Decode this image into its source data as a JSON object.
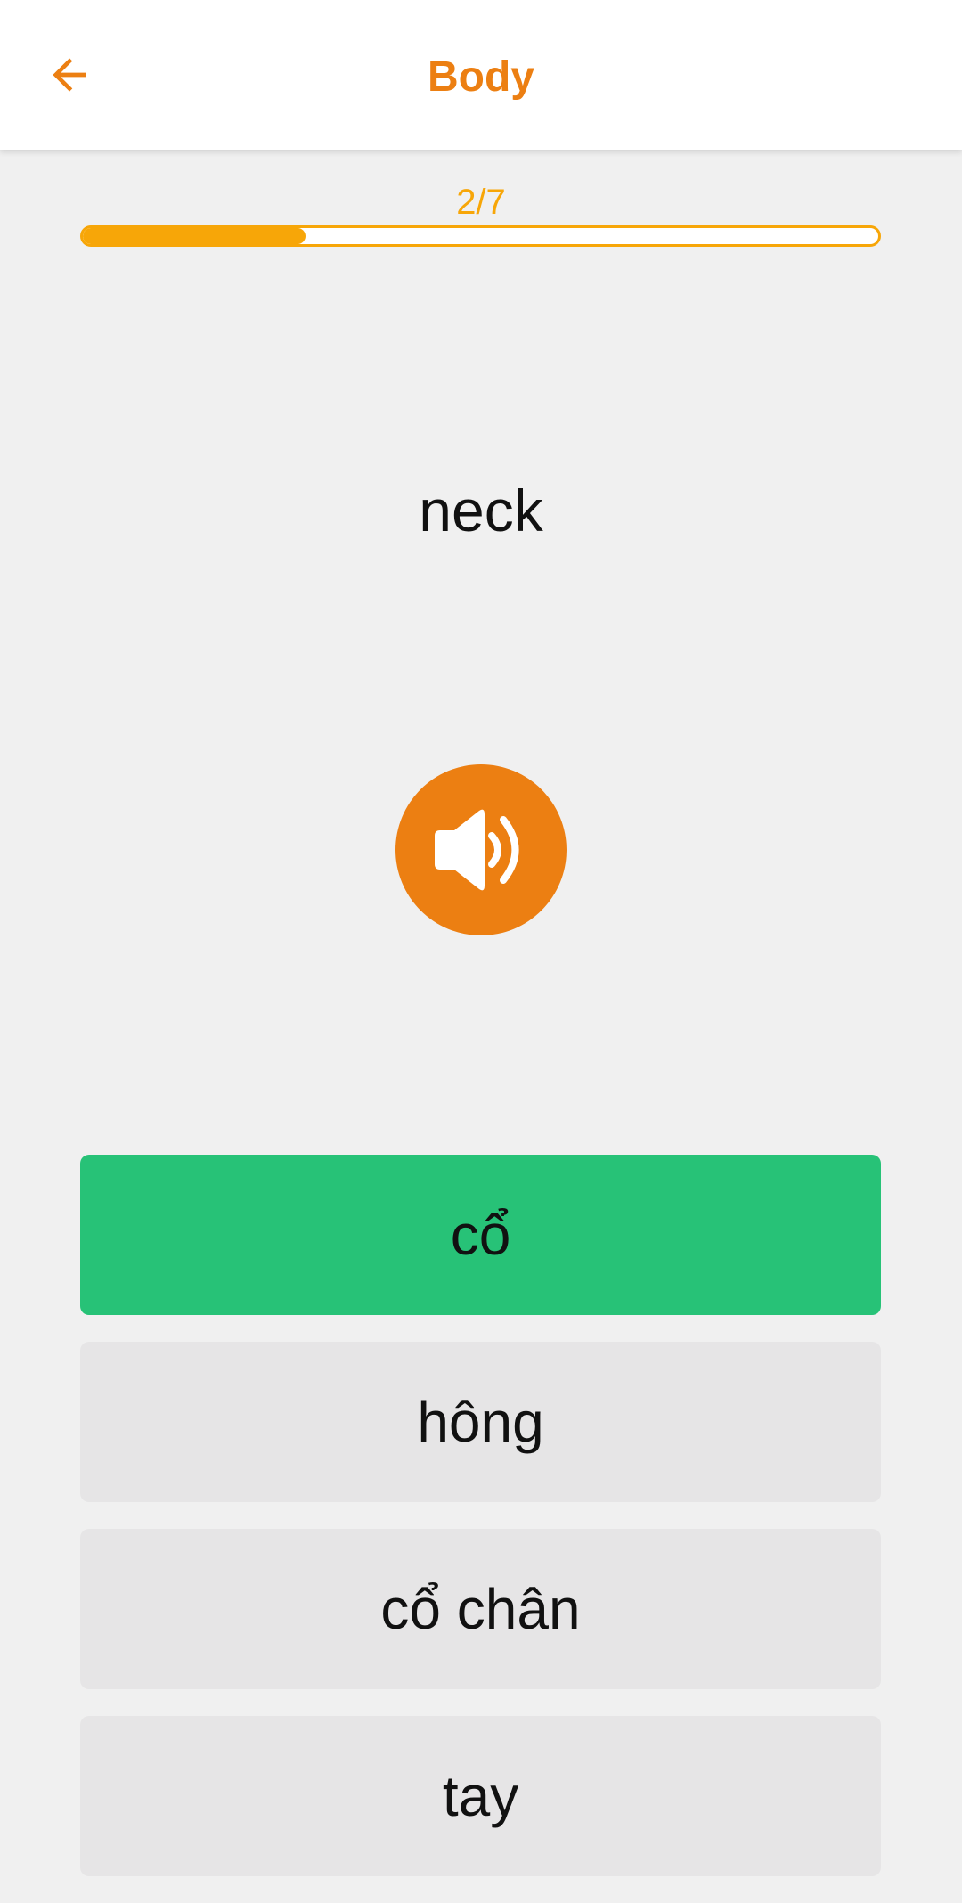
{
  "header": {
    "title": "Body",
    "back_icon": "arrow-left-icon"
  },
  "progress": {
    "label": "2/7",
    "fraction": 0.28
  },
  "question": {
    "word": "neck",
    "audio_icon": "speaker-icon"
  },
  "options": [
    {
      "label": "cổ",
      "state": "correct"
    },
    {
      "label": "hông",
      "state": "default"
    },
    {
      "label": "cổ chân",
      "state": "default"
    },
    {
      "label": "tay",
      "state": "default"
    }
  ],
  "colors": {
    "accent": "#ec7f12",
    "progress": "#f7a608",
    "correct": "#27c277",
    "option_default": "#e6e5e6",
    "background": "#f0f0f0"
  }
}
